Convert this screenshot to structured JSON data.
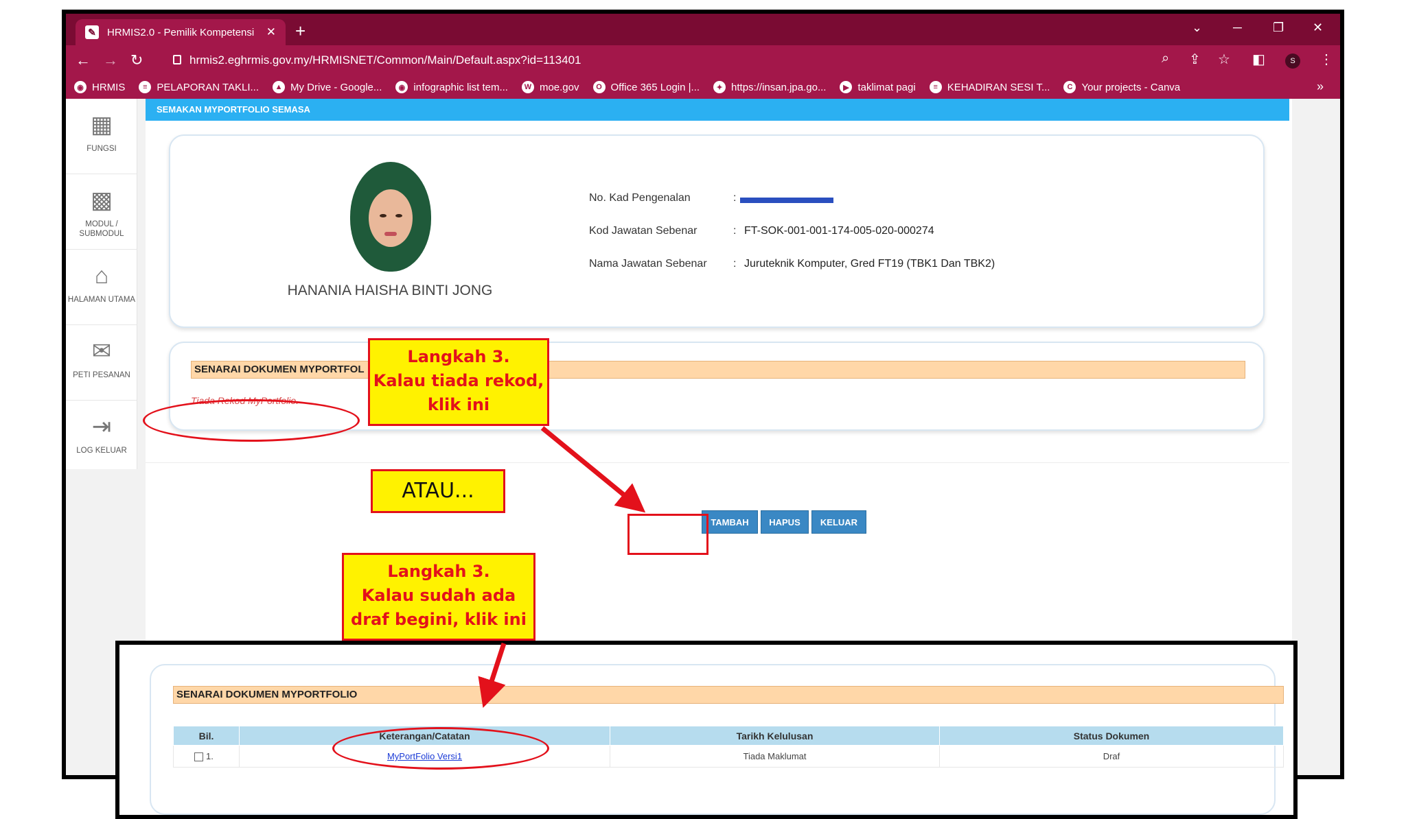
{
  "browser": {
    "tab_title": "HRMIS2.0 - Pemilik Kompetensi",
    "url": "hrmis2.eghrmis.gov.my/HRMISNET/Common/Main/Default.aspx?id=113401",
    "avatar_letter": "S",
    "bookmarks": [
      {
        "label": "HRMIS",
        "icon": "globe-icon"
      },
      {
        "label": "PELAPORAN TAKLI...",
        "icon": "list-icon"
      },
      {
        "label": "My Drive - Google...",
        "icon": "drive-icon"
      },
      {
        "label": "infographic list tem...",
        "icon": "globe-icon"
      },
      {
        "label": "moe.gov",
        "icon": "w-icon"
      },
      {
        "label": "Office 365 Login |...",
        "icon": "office-icon"
      },
      {
        "label": "https://insan.jpa.go...",
        "icon": "crest-icon"
      },
      {
        "label": "taklimat pagi",
        "icon": "meet-icon"
      },
      {
        "label": "KEHADIRAN SESI T...",
        "icon": "list-icon"
      },
      {
        "label": "Your projects - Canva",
        "icon": "canva-icon"
      }
    ]
  },
  "sidebar": {
    "items": [
      {
        "label": "FUNGSI",
        "icon": "grid-icon"
      },
      {
        "label": "MODUL / SUBMODUL",
        "icon": "modules-icon"
      },
      {
        "label": "HALAMAN UTAMA",
        "icon": "home-icon"
      },
      {
        "label": "PETI PESANAN",
        "icon": "mail-icon"
      },
      {
        "label": "LOG KELUAR",
        "icon": "logout-icon"
      }
    ]
  },
  "header": {
    "title": "SEMAKAN MYPORTFOLIO SEMASA"
  },
  "profile": {
    "name": "HANANIA HAISHA BINTI JONG",
    "ic_label": "No. Kad Pengenalan",
    "ic_value": "",
    "kod_label": "Kod Jawatan Sebenar",
    "kod_value": "FT-SOK-001-001-174-005-020-000274",
    "nama_label": "Nama Jawatan Sebenar",
    "nama_value": "Juruteknik Komputer, Gred FT19 (TBK1 Dan TBK2)",
    "colon": ":"
  },
  "list": {
    "title": "SENARAI DOKUMEN MYPORTFOL",
    "empty_text": "Tiada Rekod MyPortfolio."
  },
  "buttons": {
    "add": "TAMBAH",
    "delete": "HAPUS",
    "exit": "KELUAR"
  },
  "annotations": {
    "callout1": [
      "Langkah 3.",
      "Kalau tiada rekod,",
      "klik ini"
    ],
    "atau": "ATAU...",
    "callout2": [
      "Langkah 3.",
      "Kalau sudah ada",
      "draf begini, klik ini"
    ]
  },
  "inset": {
    "title": "SENARAI DOKUMEN MYPORTFOLIO",
    "columns": [
      "Bil.",
      "Keterangan/Catatan",
      "Tarikh Kelulusan",
      "Status Dokumen"
    ],
    "rows": [
      {
        "bil": "1.",
        "keterangan": "MyPortFolio Versi1",
        "tarikh": "Tiada Maklumat",
        "status": "Draf"
      }
    ]
  }
}
